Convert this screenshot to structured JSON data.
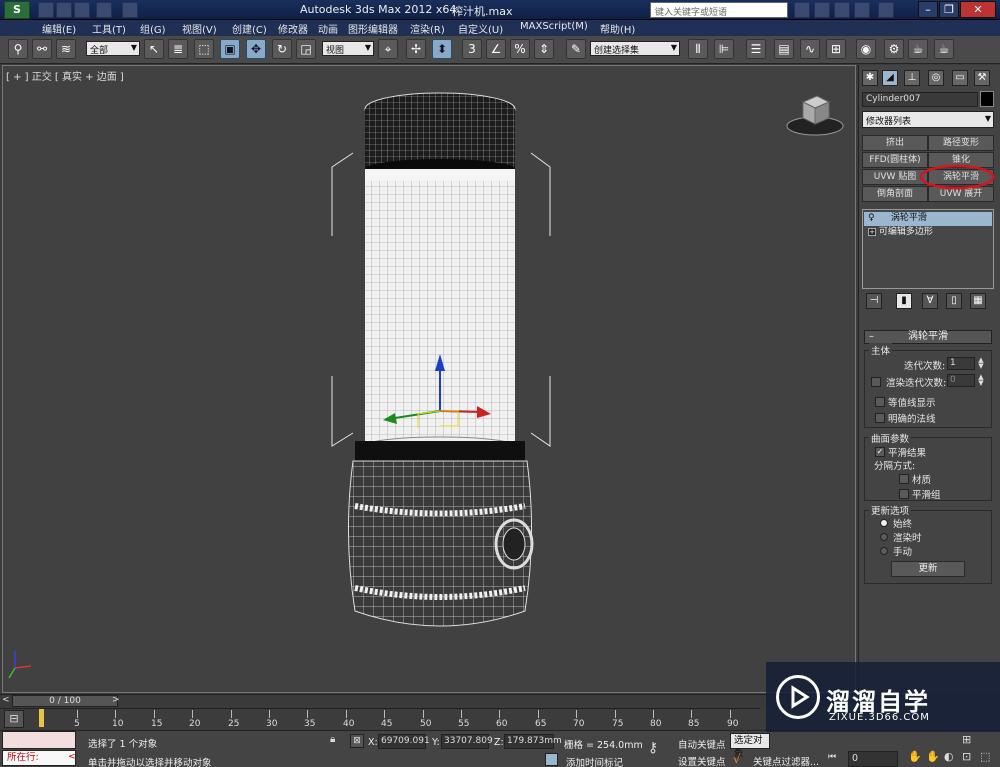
{
  "window": {
    "title": "Autodesk 3ds Max  2012 x64",
    "file": "榨汁机.max",
    "search_placeholder": "键入关键字或短语"
  },
  "menu": [
    "编辑(E)",
    "工具(T)",
    "组(G)",
    "视图(V)",
    "创建(C)",
    "修改器",
    "动画",
    "图形编辑器",
    "渲染(R)",
    "自定义(U)",
    "MAXScript(M)",
    "帮助(H)"
  ],
  "toolbar": {
    "selection_filter": "全部",
    "ref_coord": "视图",
    "named_selection": "创建选择集"
  },
  "viewport": {
    "label": "[ + ] 正交 [ 真实 + 边面 ]"
  },
  "command_panel": {
    "object_name": "Cylinder007",
    "modifier_list": "修改器列表",
    "modifier_buttons": [
      {
        "label": "挤出"
      },
      {
        "label": "路径变形"
      },
      {
        "label": "FFD(圆柱体)"
      },
      {
        "label": "锥化"
      },
      {
        "label": "UVW 贴图"
      },
      {
        "label": "涡轮平滑"
      },
      {
        "label": "倒角剖面"
      },
      {
        "label": "UVW 展开"
      }
    ],
    "stack": [
      {
        "label": "涡轮平滑",
        "selected": true
      },
      {
        "label": "可编辑多边形",
        "selected": false
      }
    ],
    "rollout_title": "涡轮平滑",
    "main_group": "主体",
    "iterations_label": "迭代次数:",
    "iterations_value": "1",
    "render_iters_label": "渲染迭代次数:",
    "render_iters_value": "0",
    "isoline": "等值线显示",
    "explicit_normals": "明确的法线",
    "surface_group": "曲面参数",
    "smooth_result": "平滑结果",
    "separate_by": "分隔方式:",
    "materials": "材质",
    "smoothing_groups": "平滑组",
    "update_group": "更新选项",
    "always": "始终",
    "when_rendering": "渲染时",
    "manually": "手动",
    "update_button": "更新"
  },
  "timeline": {
    "frame": "0 / 100",
    "ticks": [
      "5",
      "10",
      "15",
      "20",
      "25",
      "30",
      "35",
      "40",
      "45",
      "50",
      "55",
      "60",
      "65",
      "70",
      "75",
      "80",
      "85",
      "90"
    ]
  },
  "status": {
    "running": "所在行:",
    "selected": "选择了 1 个对象",
    "prompt": "单击并拖动以选择并移动对象",
    "x": "69709.091",
    "y": "33707.809",
    "z": "179.873mm",
    "grid": "栅格 = 254.0mm",
    "add_time_tag": "添加时间标记",
    "auto_key": "自动关键点",
    "selected_obj": "选定对象",
    "set_key": "设置关键点",
    "key_filters": "关键点过滤器...",
    "frame_field": "0"
  },
  "watermark": {
    "title": "溜溜自学",
    "url": "ZIXUE.3D66.COM"
  },
  "colors": {
    "highlight_circle": "#d8141a"
  }
}
